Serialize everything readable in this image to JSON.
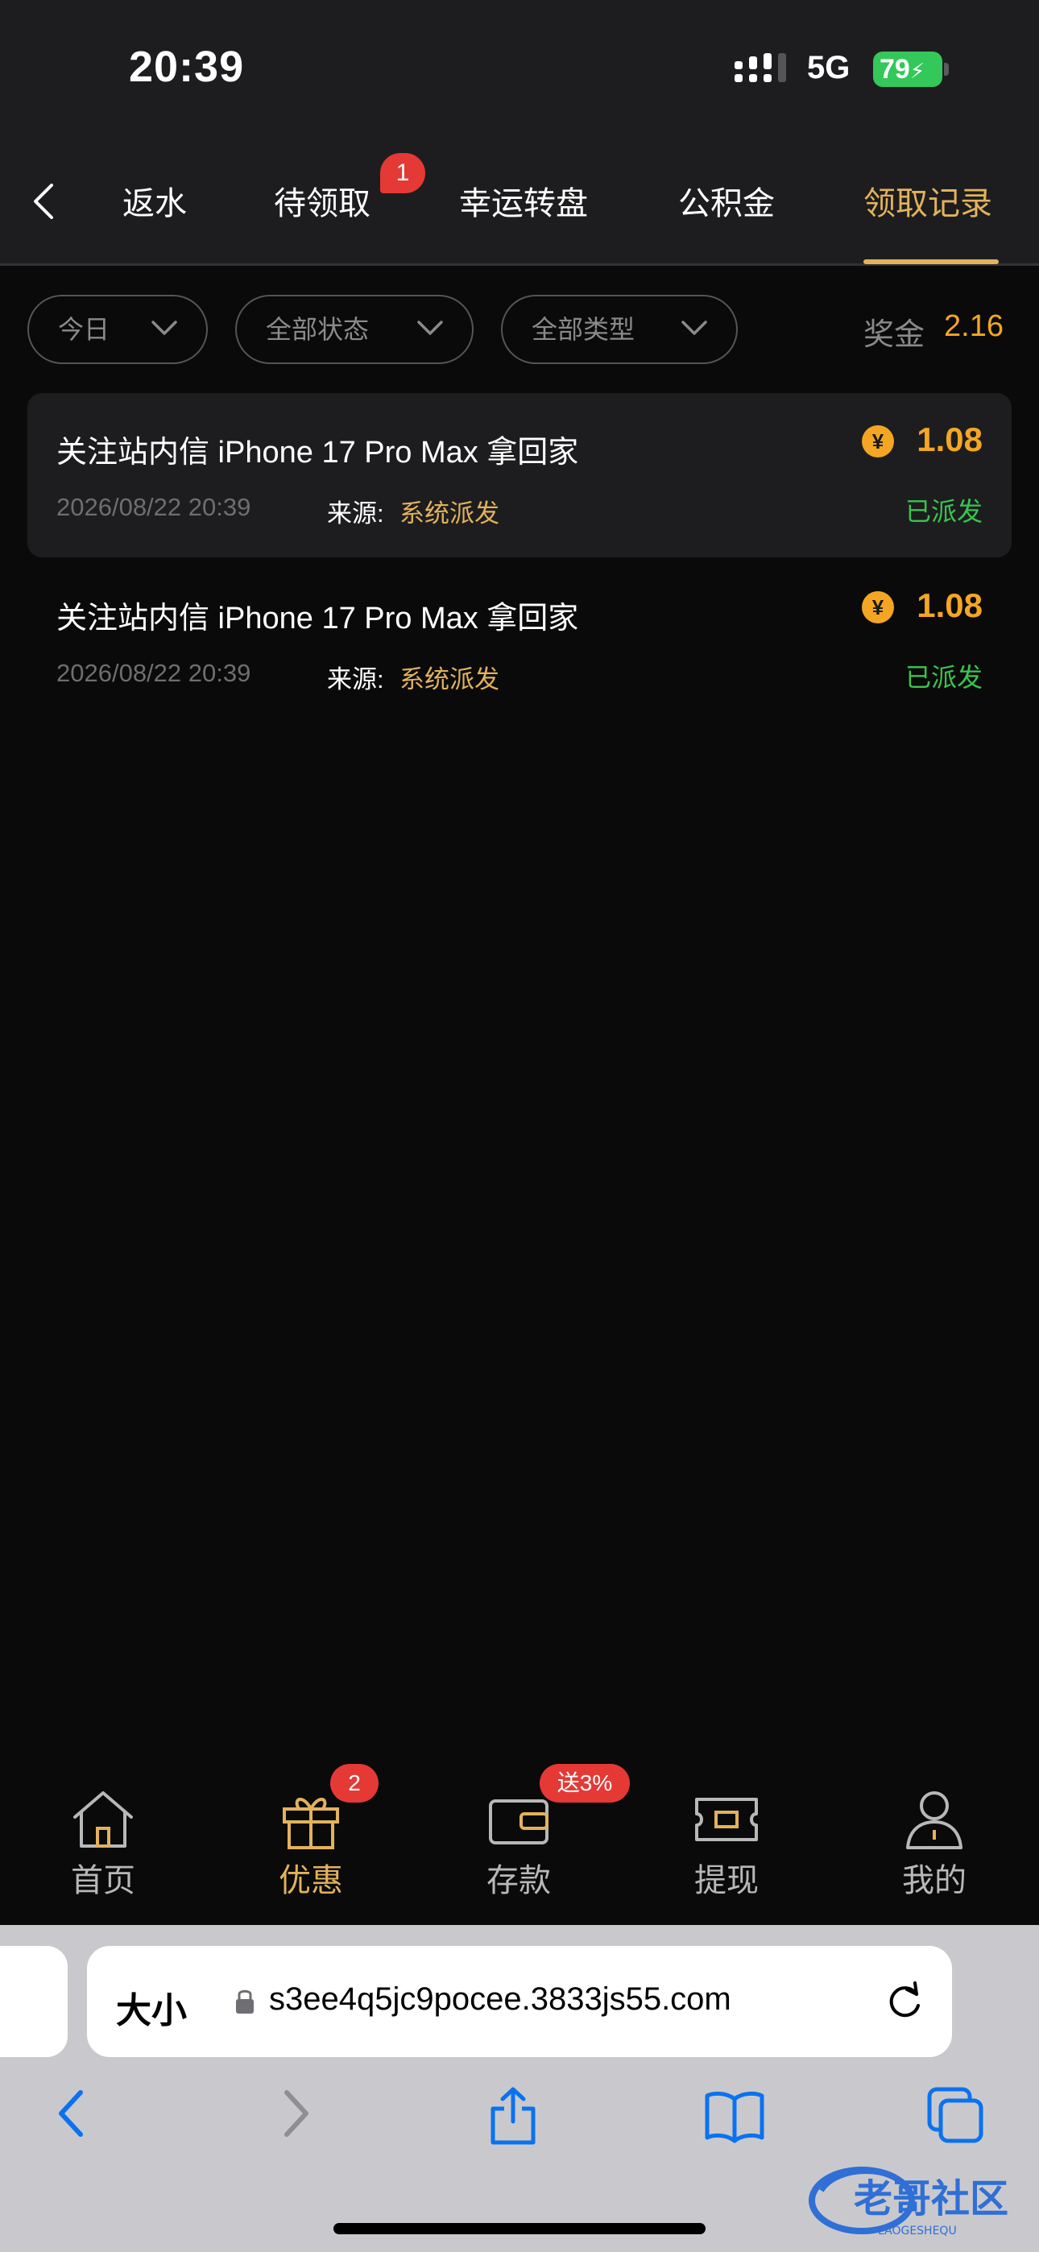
{
  "status_bar": {
    "time": "20:39",
    "network": "5G",
    "battery": "79"
  },
  "tabs": [
    {
      "label": "返水"
    },
    {
      "label": "待领取",
      "badge": "1"
    },
    {
      "label": "幸运转盘"
    },
    {
      "label": "公积金"
    },
    {
      "label": "领取记录",
      "active": true
    }
  ],
  "filters": [
    {
      "label": "今日"
    },
    {
      "label": "全部状态"
    },
    {
      "label": "全部类型"
    }
  ],
  "bonus": {
    "label": "奖金",
    "value": "2.16"
  },
  "records": [
    {
      "title": "关注站内信 iPhone 17 Pro Max 拿回家",
      "time": "2026/08/22 20:39",
      "source_label": "来源:",
      "source": "系统派发",
      "amount": "1.08",
      "status": "已派发",
      "coin": "¥"
    },
    {
      "title": "关注站内信 iPhone 17 Pro Max 拿回家",
      "time": "2026/08/22 20:39",
      "source_label": "来源:",
      "source": "系统派发",
      "amount": "1.08",
      "status": "已派发",
      "coin": "¥"
    }
  ],
  "app_nav": [
    {
      "label": "首页",
      "icon": "home-icon"
    },
    {
      "label": "优惠",
      "icon": "gift-icon",
      "active": true,
      "badge": "2"
    },
    {
      "label": "存款",
      "icon": "wallet-icon",
      "badge": "送3%"
    },
    {
      "label": "提现",
      "icon": "withdraw-icon"
    },
    {
      "label": "我的",
      "icon": "profile-icon"
    }
  ],
  "browser": {
    "text_size_label": "大小",
    "url": "s3ee4q5jc9pocee.3833js55.com"
  },
  "watermark": {
    "text": "老哥社区",
    "subtext": "LAOGESHEQU"
  },
  "colors": {
    "accent": "#e2b25c",
    "amount": "#f4a623",
    "success": "#39c54e",
    "badge": "#e53935"
  }
}
